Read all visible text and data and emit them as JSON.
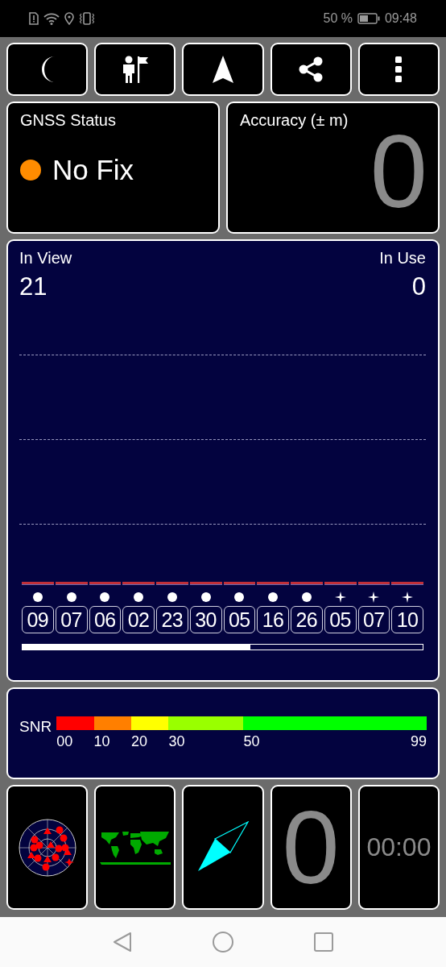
{
  "status_bar": {
    "battery": "50 %",
    "time": "09:48"
  },
  "gnss_status": {
    "title": "GNSS Status",
    "fix": false,
    "status": "No Fix"
  },
  "accuracy": {
    "title": "Accuracy (± m)",
    "value": "0"
  },
  "satellites": {
    "in_view_label": "In View",
    "in_view": "21",
    "in_use_label": "In Use",
    "in_use": "0",
    "list": [
      {
        "id": "09",
        "kind": "dot"
      },
      {
        "id": "07",
        "kind": "dot"
      },
      {
        "id": "06",
        "kind": "dot"
      },
      {
        "id": "02",
        "kind": "dot"
      },
      {
        "id": "23",
        "kind": "dot"
      },
      {
        "id": "30",
        "kind": "dot"
      },
      {
        "id": "05",
        "kind": "dot"
      },
      {
        "id": "16",
        "kind": "dot"
      },
      {
        "id": "26",
        "kind": "dot"
      },
      {
        "id": "05",
        "kind": "star"
      },
      {
        "id": "07",
        "kind": "star"
      },
      {
        "id": "10",
        "kind": "star"
      }
    ],
    "progress": {
      "level": 0.57
    }
  },
  "snr": {
    "label": "SNR",
    "stops": [
      {
        "label": "00",
        "color": "#ff0000"
      },
      {
        "label": "10",
        "color": "#ff7f00"
      },
      {
        "label": "20",
        "color": "#ffff00"
      },
      {
        "label": "30",
        "color": "#99ff00"
      },
      {
        "label": "50",
        "color": "#00ff00"
      }
    ],
    "end_label": "99"
  },
  "tiles": {
    "speed": "0",
    "time": "00:00"
  }
}
